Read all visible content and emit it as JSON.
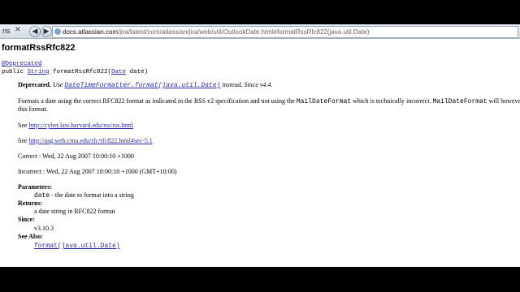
{
  "browser": {
    "tab_label": "ns",
    "url_host": "docs.atlassian.com",
    "url_path": "/jira/latest/com/atlassian/jira/web/util/OutlookDate.html#formatRssRfc822(java.util.Date)"
  },
  "doc": {
    "method_name": "formatRssRfc822",
    "annotation": "@Deprecated",
    "signature_prefix": "public ",
    "return_type": "String",
    "signature_mid": " formatRssRfc822(",
    "param_type": "Date",
    "signature_suffix": " date)",
    "deprecated_label": "Deprecated.",
    "deprecated_use": "Use ",
    "deprecated_link": "DateTimeFormatter.format(java.util.Date)",
    "deprecated_tail": " instead. Since v4.4.",
    "description_line1_a": "Formats a date using the correct RFC822 format as indicated in the RSS v2 specification and not using the ",
    "description_code1": "MailDateFormat",
    "description_line1_b": " which is technically incorrect. ",
    "description_code2": "MailDateFormat",
    "description_line1_c": " will however parse",
    "description_line2": "this format.",
    "see1_prefix": "See ",
    "see1_link": "http://cyber.law.harvard.edu/rss/rss.html",
    "see2_prefix": "See ",
    "see2_link": "http://asg.web.cmu.edu/rfc/rfc822.html#sec-5.1",
    "correct": "Correct : Wed, 22 Aug 2007 10:00:10 +1000",
    "incorrect": "Incorrect : Wed, 22 Aug 2007 10:00:10 +1000 (GMT+10:00)",
    "parameters_label": "Parameters:",
    "param_name": "date",
    "param_desc": " - the date to format into a string",
    "returns_label": "Returns:",
    "returns_desc": "a date string in RFC822 format",
    "since_label": "Since:",
    "since_value": "v3.10.3",
    "see_also_label": "See Also:",
    "see_also_link": "format(java.util.Date)"
  }
}
